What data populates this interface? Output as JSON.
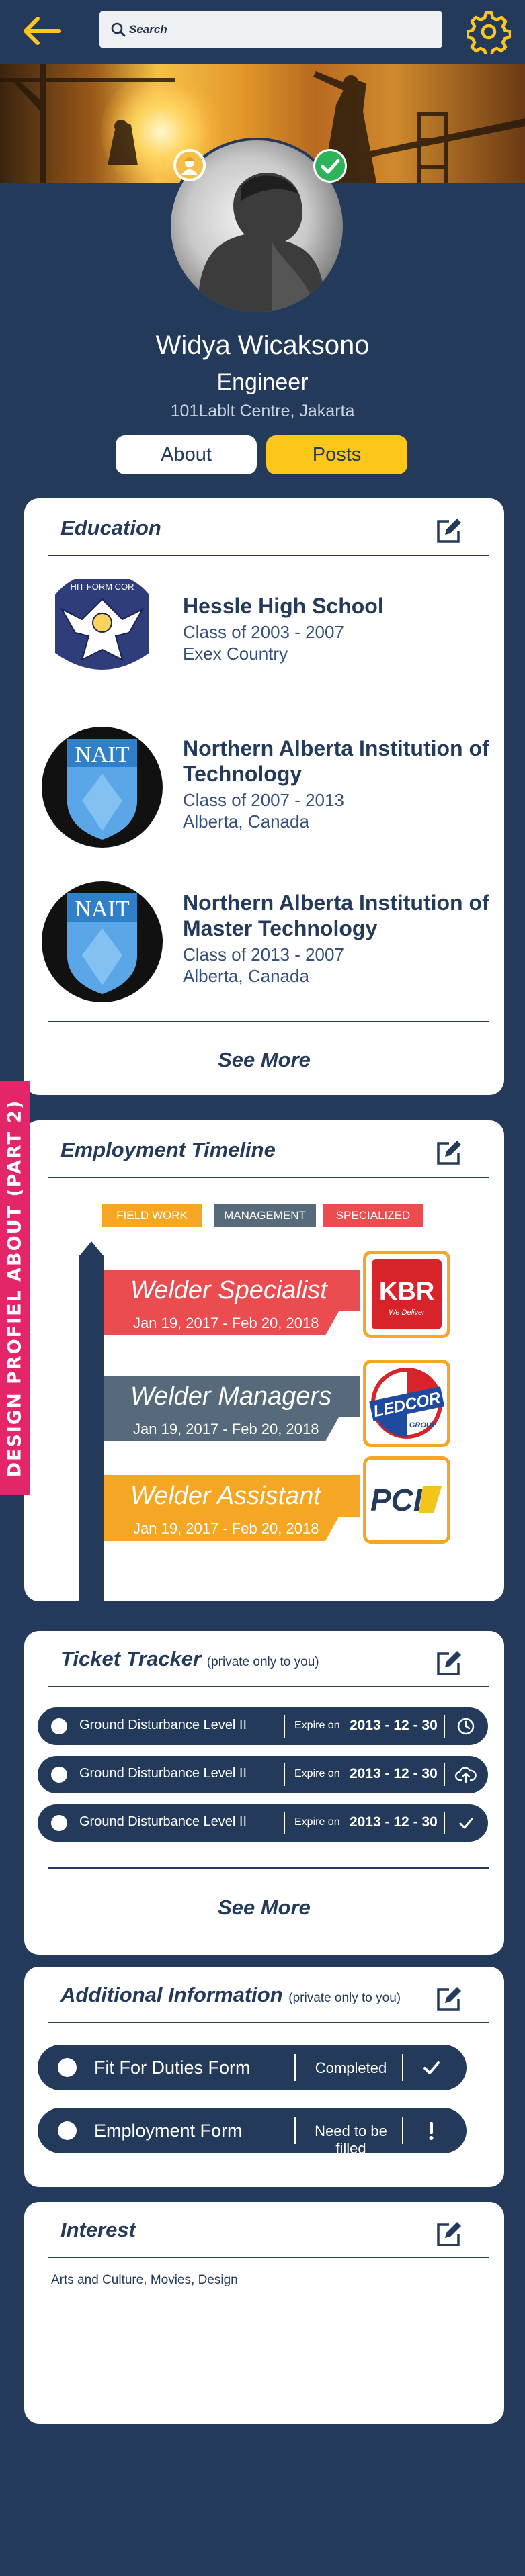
{
  "header": {
    "search_placeholder": "Search",
    "back_icon": "arrow-left-icon",
    "settings_icon": "gear-icon",
    "accent": "#fdc61a"
  },
  "profile": {
    "name": "Widya Wicaksono",
    "role": "Engineer",
    "location": "101Lablt Centre, Jakarta",
    "about_label": "About",
    "posts_label": "Posts"
  },
  "education": {
    "title": "Education",
    "see_more": "See More",
    "items": [
      {
        "school": "Hessle High School",
        "class": "Class of 2003 - 2007",
        "place": "Exex Country",
        "logo": "eagle-crest-logo",
        "logo_text": "HIT FORM COR"
      },
      {
        "school": "Northern Alberta Institution of Technology",
        "class": "Class of 2007 - 2013",
        "place": "Alberta, Canada",
        "logo": "nait-logo",
        "logo_text": "NAIT"
      },
      {
        "school": "Northern Alberta Institution of Master Technology",
        "class": "Class of 2013 - 2007",
        "place": "Alberta, Canada",
        "logo": "nait-logo",
        "logo_text": "NAIT"
      }
    ]
  },
  "employment": {
    "title": "Employment Timeline",
    "tags": [
      {
        "label": "FIELD WORK",
        "color": "#f5a623"
      },
      {
        "label": "MANAGEMENT",
        "color": "#566a7b"
      },
      {
        "label": "SPECIALIZED",
        "color": "#ea4c50"
      }
    ],
    "jobs": [
      {
        "title": "Welder Specialist",
        "dates": "Jan 19, 2017 - Feb 20, 2018",
        "color": "#ea4c50",
        "company": "KBR",
        "company_tagline": "We Deliver"
      },
      {
        "title": "Welder Managers",
        "dates": "Jan 19, 2017 - Feb 20, 2018",
        "color": "#566a7b",
        "company": "LEDCOR",
        "company_tagline": "GROUP"
      },
      {
        "title": "Welder Assistant",
        "dates": "Jan 19, 2017 - Feb 20, 2018",
        "color": "#f5a623",
        "company": "PCL",
        "company_tagline": ""
      }
    ]
  },
  "tickets": {
    "title": "Ticket Tracker",
    "note": "(private only to you)",
    "see_more": "See More",
    "items": [
      {
        "name": "Ground Disturbance Level II",
        "expire_label": "Expire on",
        "date": "2013 - 12 - 30",
        "icon": "clock-icon"
      },
      {
        "name": "Ground Disturbance Level II",
        "expire_label": "Expire on",
        "date": "2013 - 12 - 30",
        "icon": "cloud-upload-icon"
      },
      {
        "name": "Ground Disturbance Level II",
        "expire_label": "Expire on",
        "date": "2013 - 12 - 30",
        "icon": "check-icon"
      }
    ]
  },
  "additional": {
    "title": "Additional Information",
    "note": "(private only to you)",
    "items": [
      {
        "name": "Fit For Duties Form",
        "status": "Completed",
        "icon": "check-icon"
      },
      {
        "name": "Employment Form",
        "status": "Need to be filled",
        "icon": "exclamation-icon"
      }
    ]
  },
  "interest": {
    "title": "Interest",
    "text": "Arts and Culture, Movies, Design"
  },
  "ribbon": {
    "text": "DESIGN PROFIEL ABOUT (PART 2)",
    "color": "#e5256a"
  }
}
